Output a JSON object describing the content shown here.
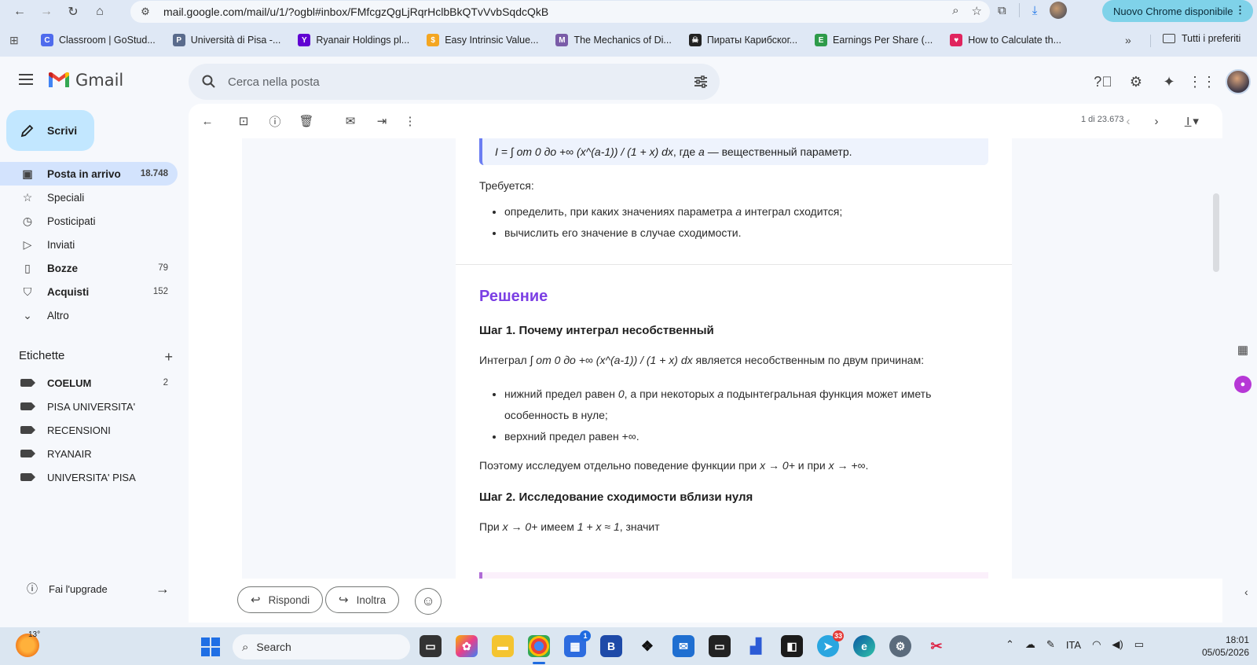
{
  "browser": {
    "url": "mail.google.com/mail/u/1/?ogbl#inbox/FMfcgzQgLjRqrHclbBkQTvVvbSqdcQkB",
    "update_label": "Nuovo Chrome disponibile",
    "bookmarks": [
      {
        "label": "Classroom | GoStud...",
        "icon": "classroom-icon",
        "color": "#4f6bed",
        "glyph": "C"
      },
      {
        "label": "Università di Pisa -...",
        "icon": "pisa-icon",
        "color": "#5a6b8c",
        "glyph": "P"
      },
      {
        "label": "Ryanair Holdings pl...",
        "icon": "yahoo-icon",
        "color": "#6001d2",
        "glyph": "Y"
      },
      {
        "label": "Easy Intrinsic Value...",
        "icon": "shield-icon",
        "color": "#f4a621",
        "glyph": "$"
      },
      {
        "label": "The Mechanics of Di...",
        "icon": "tower-icon",
        "color": "#7a5ca8",
        "glyph": "M"
      },
      {
        "label": "Пираты Карибског...",
        "icon": "pirate-icon",
        "color": "#222222",
        "glyph": "☠"
      },
      {
        "label": "Earnings Per Share (...",
        "icon": "leaf-icon",
        "color": "#2e9b4a",
        "glyph": "E"
      },
      {
        "label": "How to Calculate th...",
        "icon": "heart-icon",
        "color": "#e0245e",
        "glyph": "♥"
      }
    ],
    "bookmarks_folder": "Tutti i preferiti"
  },
  "gmail": {
    "app_name": "Gmail",
    "search_placeholder": "Cerca nella posta",
    "compose_label": "Scrivi",
    "nav": [
      {
        "label": "Posta in arrivo",
        "count": "18.748",
        "icon": "▣",
        "active": true,
        "bold": true
      },
      {
        "label": "Speciali",
        "count": "",
        "icon": "☆",
        "active": false,
        "bold": false
      },
      {
        "label": "Posticipati",
        "count": "",
        "icon": "◷",
        "active": false,
        "bold": false
      },
      {
        "label": "Inviati",
        "count": "",
        "icon": "▷",
        "active": false,
        "bold": false
      },
      {
        "label": "Bozze",
        "count": "79",
        "icon": "▯",
        "active": false,
        "bold": true
      },
      {
        "label": "Acquisti",
        "count": "152",
        "icon": "⛉",
        "active": false,
        "bold": true
      },
      {
        "label": "Altro",
        "count": "",
        "icon": "⌄",
        "active": false,
        "bold": false
      }
    ],
    "labels_header": "Etichette",
    "labels": [
      {
        "label": "COELUM",
        "count": "2",
        "bold": true
      },
      {
        "label": "PISA UNIVERSITA'",
        "count": "",
        "bold": false
      },
      {
        "label": "RECENSIONI",
        "count": "",
        "bold": false
      },
      {
        "label": "RYANAIR",
        "count": "",
        "bold": false
      },
      {
        "label": "UNIVERSITA' PISA",
        "count": "",
        "bold": false
      }
    ],
    "upgrade_label": "Fai l'upgrade",
    "pager": "1 di 23.673",
    "reply_label": "Rispondi",
    "forward_label": "Inoltra"
  },
  "message": {
    "quote_formula": "I = ∫ от 0 до +∞ (x^(a-1)) / (1 + x) dx",
    "quote_tail": ", где ",
    "quote_param": "a",
    "quote_end": " — вещественный параметр.",
    "required": "Требуется:",
    "req_bullets": [
      "определить, при каких значениях параметра a интеграл сходится;",
      "вычислить его значение в случае сходимости."
    ],
    "solution_title": "Решение",
    "step1_title": "Шаг 1. Почему интеграл несобственный",
    "step1_intro_a": "Интеграл ",
    "step1_intro_formula": "∫ от 0 до +∞ (x^(a-1)) / (1 + x) dx",
    "step1_intro_b": " является несобственным по двум причинам:",
    "step1_bullets": [
      "нижний предел равен 0, а при некоторых a подынтегральная функция может иметь особенность в нуле;",
      "верхний предел равен +∞."
    ],
    "step1_conclusion": "Поэтому исследуем отдельно поведение функции при x → 0+ и при x → +∞.",
    "step2_title": "Шаг 2. Исследование сходимости вблизи нуля",
    "step2_text": "При x → 0+ имеем 1 + x ≈ 1, значит"
  },
  "taskbar": {
    "temperature": "13°",
    "search_label": "Search",
    "language": "ITA",
    "time": "18:01",
    "date": "05/05/2026",
    "badges": {
      "outlook_store": "1",
      "telegram": "33"
    }
  }
}
